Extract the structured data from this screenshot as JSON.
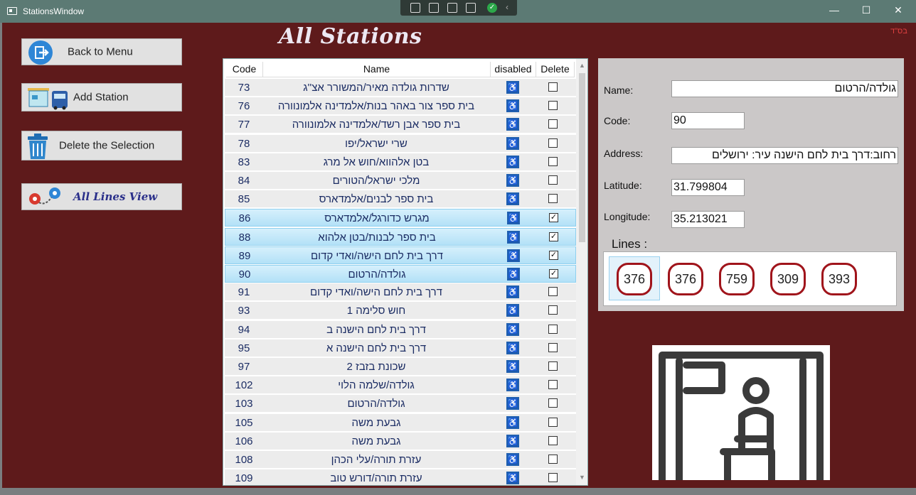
{
  "window": {
    "title": "StationsWindow",
    "minimize": "—",
    "maximize": "☐",
    "close": "✕"
  },
  "corner_text": "בס\"ד",
  "heading": "All Stations",
  "sidebar": {
    "back": "Back to Menu",
    "add": "Add Station",
    "delete": "Delete the Selection",
    "lines_view": "All Lines View"
  },
  "grid": {
    "columns": {
      "code": "Code",
      "name": "Name",
      "disabled": "disabled",
      "delete": "Delete"
    },
    "rows": [
      {
        "code": "73",
        "name": "שדרות גולדה מאיר/המשורר אצ''ג",
        "checked": false
      },
      {
        "code": "76",
        "name": "בית ספר צור באהר בנות/אלמדינה אלמונוורה",
        "checked": false
      },
      {
        "code": "77",
        "name": "בית ספר אבן רשד/אלמדינה אלמונוורה",
        "checked": false
      },
      {
        "code": "78",
        "name": "שרי ישראל/יפו",
        "checked": false
      },
      {
        "code": "83",
        "name": "בטן אלהווא/חוש אל מרג",
        "checked": false
      },
      {
        "code": "84",
        "name": "מלכי ישראל/הטורים",
        "checked": false
      },
      {
        "code": "85",
        "name": "בית ספר לבנים/אלמדארס",
        "checked": false
      },
      {
        "code": "86",
        "name": "מגרש כדורגל/אלמדארס",
        "checked": true
      },
      {
        "code": "88",
        "name": "בית ספר לבנות/בטן אלהוא",
        "checked": true
      },
      {
        "code": "89",
        "name": "דרך בית לחם הישה/ואדי קדום",
        "checked": true
      },
      {
        "code": "90",
        "name": "גולדה/הרטום",
        "checked": true
      },
      {
        "code": "91",
        "name": "דרך בית לחם הישה/ואדי קדום",
        "checked": false
      },
      {
        "code": "93",
        "name": "חוש סלימה 1",
        "checked": false
      },
      {
        "code": "94",
        "name": "דרך בית לחם הישנה ב",
        "checked": false
      },
      {
        "code": "95",
        "name": "דרך בית לחם הישנה א",
        "checked": false
      },
      {
        "code": "97",
        "name": "שכונת בזבז 2",
        "checked": false
      },
      {
        "code": "102",
        "name": "גולדה/שלמה הלוי",
        "checked": false
      },
      {
        "code": "103",
        "name": "גולדה/הרטום",
        "checked": false
      },
      {
        "code": "105",
        "name": "גבעת משה",
        "checked": false
      },
      {
        "code": "106",
        "name": "גבעת משה",
        "checked": false
      },
      {
        "code": "108",
        "name": "עזרת תורה/עלי הכהן",
        "checked": false
      },
      {
        "code": "109",
        "name": "עזרת תורה/דורש טוב",
        "checked": false
      }
    ]
  },
  "details": {
    "name_label": "Name:",
    "name_value": "גולדה/הרטום",
    "code_label": "Code:",
    "code_value": "90",
    "address_label": "Address:",
    "address_value": "רחוב:דרך בית לחם הישנה  עיר: ירושלים",
    "lat_label": "Latitude:",
    "lat_value": "31.799804",
    "lon_label": "Longitude:",
    "lon_value": "35.213021",
    "lines_label": "Lines :",
    "lines": [
      "376",
      "376",
      "759",
      "309",
      "393"
    ]
  },
  "colors": {
    "background": "#5e1a1b",
    "line_border": "#a0141b",
    "selection": "#b3e1f7"
  }
}
